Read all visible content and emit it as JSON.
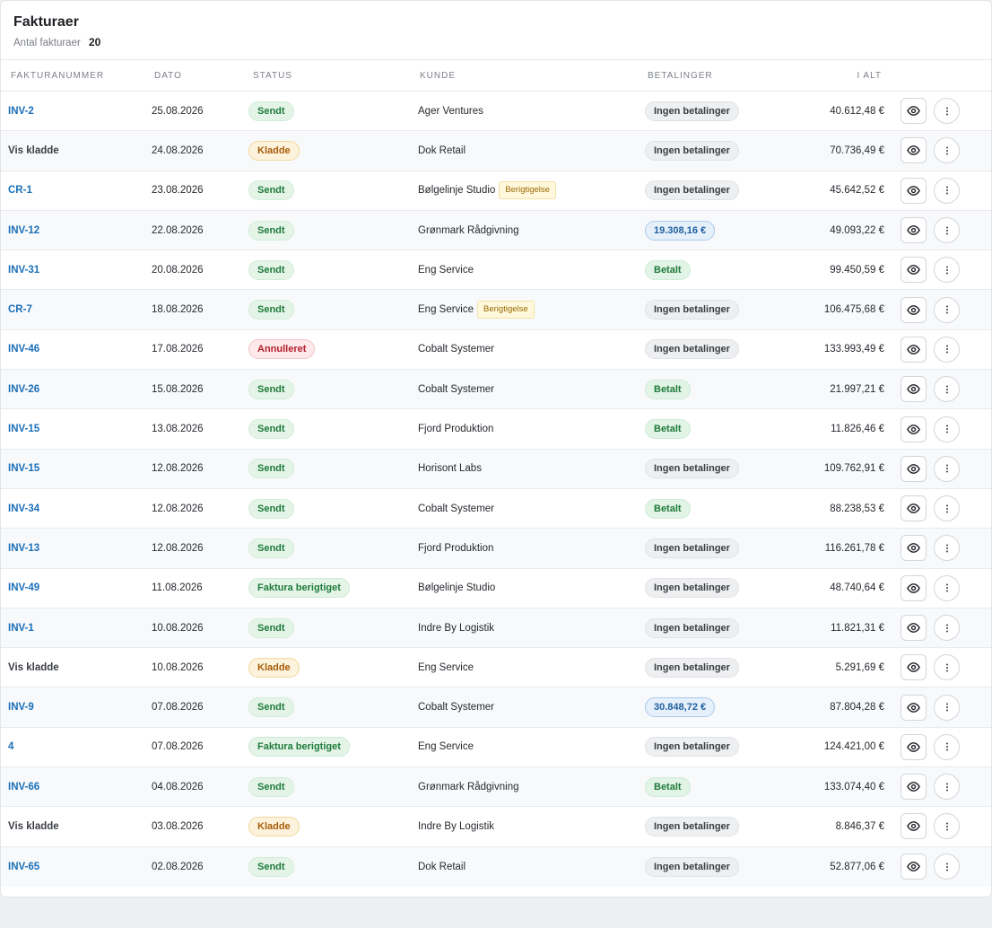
{
  "header": {
    "title": "Fakturaer",
    "count_label": "Antal fakturaer",
    "count_value": "20"
  },
  "columns": {
    "number": "FAKTURANUMMER",
    "date": "DATO",
    "status": "STATUS",
    "customer": "KUNDE",
    "payments": "BETALINGER",
    "total": "I ALT"
  },
  "rows": [
    {
      "number": "INV-2",
      "number_type": "link",
      "date": "25.08.2026",
      "status": "Sendt",
      "status_type": "sendt",
      "customer": "Ager Ventures",
      "tag": "",
      "payment": "Ingen betalinger",
      "payment_type": "none",
      "total": "40.612,48 €"
    },
    {
      "number": "Vis kladde",
      "number_type": "draft",
      "date": "24.08.2026",
      "status": "Kladde",
      "status_type": "kladde",
      "customer": "Dok Retail",
      "tag": "",
      "payment": "Ingen betalinger",
      "payment_type": "none",
      "total": "70.736,49 €"
    },
    {
      "number": "CR-1",
      "number_type": "link",
      "date": "23.08.2026",
      "status": "Sendt",
      "status_type": "sendt",
      "customer": "Bølgelinje Studio",
      "tag": "Berigtigelse",
      "payment": "Ingen betalinger",
      "payment_type": "none",
      "total": "45.642,52 €"
    },
    {
      "number": "INV-12",
      "number_type": "link",
      "date": "22.08.2026",
      "status": "Sendt",
      "status_type": "sendt",
      "customer": "Grønmark Rådgivning",
      "tag": "",
      "payment": "19.308,16 €",
      "payment_type": "partial",
      "total": "49.093,22 €"
    },
    {
      "number": "INV-31",
      "number_type": "link",
      "date": "20.08.2026",
      "status": "Sendt",
      "status_type": "sendt",
      "customer": "Eng Service",
      "tag": "",
      "payment": "Betalt",
      "payment_type": "paid",
      "total": "99.450,59 €"
    },
    {
      "number": "CR-7",
      "number_type": "link",
      "date": "18.08.2026",
      "status": "Sendt",
      "status_type": "sendt",
      "customer": "Eng Service",
      "tag": "Berigtigelse",
      "payment": "Ingen betalinger",
      "payment_type": "none",
      "total": "106.475,68 €"
    },
    {
      "number": "INV-46",
      "number_type": "link",
      "date": "17.08.2026",
      "status": "Annulleret",
      "status_type": "annulleret",
      "customer": "Cobalt Systemer",
      "tag": "",
      "payment": "Ingen betalinger",
      "payment_type": "none",
      "total": "133.993,49 €"
    },
    {
      "number": "INV-26",
      "number_type": "link",
      "date": "15.08.2026",
      "status": "Sendt",
      "status_type": "sendt",
      "customer": "Cobalt Systemer",
      "tag": "",
      "payment": "Betalt",
      "payment_type": "paid",
      "total": "21.997,21 €"
    },
    {
      "number": "INV-15",
      "number_type": "link",
      "date": "13.08.2026",
      "status": "Sendt",
      "status_type": "sendt",
      "customer": "Fjord Produktion",
      "tag": "",
      "payment": "Betalt",
      "payment_type": "paid",
      "total": "11.826,46 €"
    },
    {
      "number": "INV-15",
      "number_type": "link",
      "date": "12.08.2026",
      "status": "Sendt",
      "status_type": "sendt",
      "customer": "Horisont Labs",
      "tag": "",
      "payment": "Ingen betalinger",
      "payment_type": "none",
      "total": "109.762,91 €"
    },
    {
      "number": "INV-34",
      "number_type": "link",
      "date": "12.08.2026",
      "status": "Sendt",
      "status_type": "sendt",
      "customer": "Cobalt Systemer",
      "tag": "",
      "payment": "Betalt",
      "payment_type": "paid",
      "total": "88.238,53 €"
    },
    {
      "number": "INV-13",
      "number_type": "link",
      "date": "12.08.2026",
      "status": "Sendt",
      "status_type": "sendt",
      "customer": "Fjord Produktion",
      "tag": "",
      "payment": "Ingen betalinger",
      "payment_type": "none",
      "total": "116.261,78 €"
    },
    {
      "number": "INV-49",
      "number_type": "link",
      "date": "11.08.2026",
      "status": "Faktura berigtiget",
      "status_type": "berigtiget",
      "customer": "Bølgelinje Studio",
      "tag": "",
      "payment": "Ingen betalinger",
      "payment_type": "none",
      "total": "48.740,64 €"
    },
    {
      "number": "INV-1",
      "number_type": "link",
      "date": "10.08.2026",
      "status": "Sendt",
      "status_type": "sendt",
      "customer": "Indre By Logistik",
      "tag": "",
      "payment": "Ingen betalinger",
      "payment_type": "none",
      "total": "11.821,31 €"
    },
    {
      "number": "Vis kladde",
      "number_type": "draft",
      "date": "10.08.2026",
      "status": "Kladde",
      "status_type": "kladde",
      "customer": "Eng Service",
      "tag": "",
      "payment": "Ingen betalinger",
      "payment_type": "none",
      "total": "5.291,69 €"
    },
    {
      "number": "INV-9",
      "number_type": "link",
      "date": "07.08.2026",
      "status": "Sendt",
      "status_type": "sendt",
      "customer": "Cobalt Systemer",
      "tag": "",
      "payment": "30.848,72 €",
      "payment_type": "partial",
      "total": "87.804,28 €"
    },
    {
      "number": "4",
      "number_type": "link",
      "date": "07.08.2026",
      "status": "Faktura berigtiget",
      "status_type": "berigtiget",
      "customer": "Eng Service",
      "tag": "",
      "payment": "Ingen betalinger",
      "payment_type": "none",
      "total": "124.421,00 €"
    },
    {
      "number": "INV-66",
      "number_type": "link",
      "date": "04.08.2026",
      "status": "Sendt",
      "status_type": "sendt",
      "customer": "Grønmark Rådgivning",
      "tag": "",
      "payment": "Betalt",
      "payment_type": "paid",
      "total": "133.074,40 €"
    },
    {
      "number": "Vis kladde",
      "number_type": "draft",
      "date": "03.08.2026",
      "status": "Kladde",
      "status_type": "kladde",
      "customer": "Indre By Logistik",
      "tag": "",
      "payment": "Ingen betalinger",
      "payment_type": "none",
      "total": "8.846,37 €"
    },
    {
      "number": "INV-65",
      "number_type": "link",
      "date": "02.08.2026",
      "status": "Sendt",
      "status_type": "sendt",
      "customer": "Dok Retail",
      "tag": "",
      "payment": "Ingen betalinger",
      "payment_type": "none",
      "total": "52.877,06 €"
    }
  ],
  "actions": {
    "view_icon": "eye-icon",
    "more_icon": "more-vertical-icon"
  }
}
